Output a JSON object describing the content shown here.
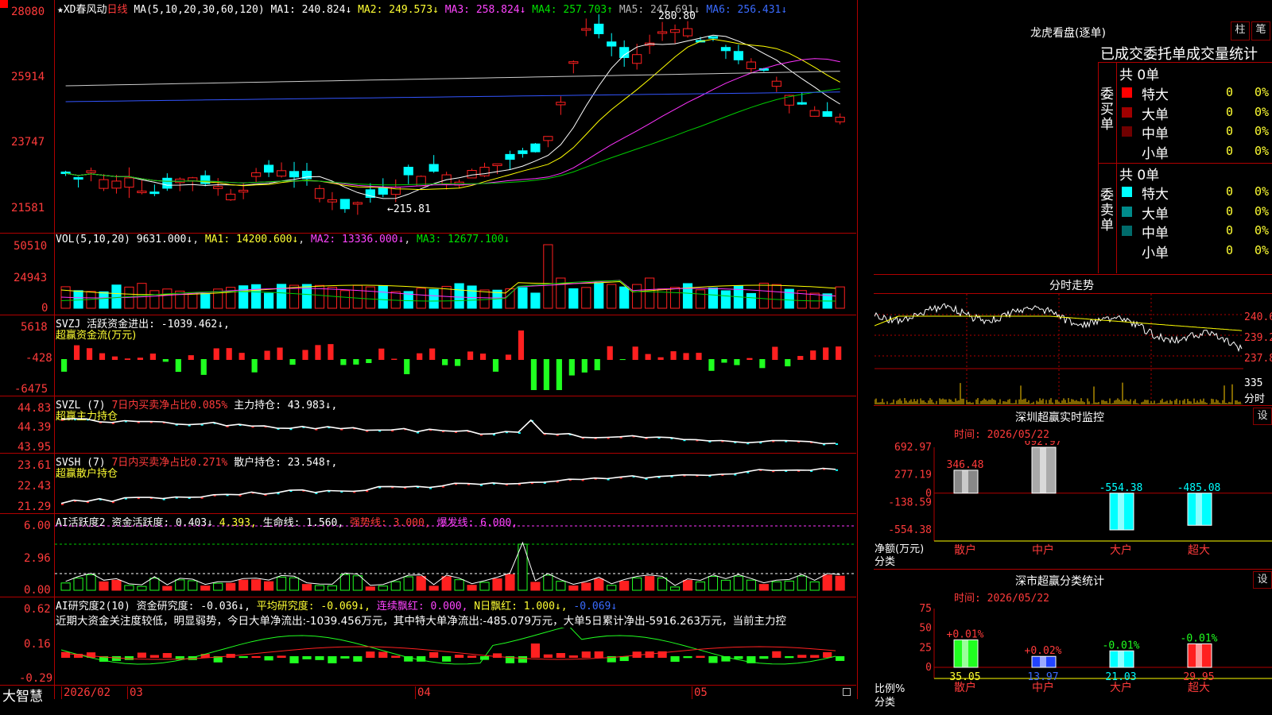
{
  "stock_name": "XD春风动",
  "period": "日线",
  "star": "★",
  "main_panel": {
    "ma_label": "MA(5,10,20,30,60,120)",
    "ma1": "MA1: 240.824↓",
    "ma2": "MA2: 249.573↓",
    "ma3": "MA3: 258.824↓",
    "ma4": "MA4: 257.703↑",
    "ma5": "MA5: 247.691↓",
    "ma6": "MA6: 256.431↓",
    "yticks": [
      "28080",
      "25914",
      "23747",
      "21581"
    ],
    "high_label": "280.80",
    "low_label": "215.81"
  },
  "vol_panel": {
    "title": "VOL(5,10,20)",
    "value": "9631.000↓",
    "ma1": "MA1: 14200.600↓",
    "ma2": "MA2: 13336.000↓",
    "ma3": "MA3: 12677.100↓",
    "yticks": [
      "50510",
      "24943",
      "0"
    ]
  },
  "svzj_panel": {
    "title": "SVZJ",
    "label": "活跃资金进出: -1039.462↓,",
    "sub": "超赢资金流(万元)",
    "yticks": [
      "5618",
      "-428",
      "-6475"
    ]
  },
  "svzl_panel": {
    "title": "SVZL (7)",
    "label1": "7日内买卖净占比0.085%",
    "label2": "主力持仓: 43.983↓,",
    "sub": "超赢主力持仓",
    "yticks": [
      "44.83",
      "44.39",
      "43.95"
    ]
  },
  "svsh_panel": {
    "title": "SVSH (7)",
    "label1": "7日内买卖净占比0.271%",
    "label2": "散户持仓: 23.548↑,",
    "sub": "超赢散户持仓",
    "yticks": [
      "23.61",
      "22.43",
      "21.29"
    ]
  },
  "ai_panel": {
    "title": "AI活跃度2",
    "label1": "资金活跃度: 0.403↓",
    "label2": "4.393,",
    "label3": "生命线: 1.560,",
    "label4": "强势线: 3.000,",
    "label5": "爆发线: 6.000,",
    "yticks": [
      "6.00",
      "2.96",
      "0.00"
    ]
  },
  "research_panel": {
    "title": "AI研究度2(10)",
    "label1": "资金研究度: -0.036↓,",
    "label2": "平均研究度: -0.069↓,",
    "label3": "连续飘红: 0.000,",
    "label4": "N日飘红: 1.000↓,",
    "label5": "-0.069↓",
    "comment": "近期大资金关注度较低，明显弱势，今日大单净流出:-1039.456万元，其中特大单净流出:-485.079万元，大单5日累计净出-5916.263万元，当前主力控",
    "yticks": [
      "0.62",
      "0.16",
      "-0.29"
    ]
  },
  "bottom_bar": {
    "brand": "大智慧",
    "dates": [
      "2026/02",
      "03",
      "04",
      "05"
    ]
  },
  "right_panel": {
    "dragon_title": "龙虎看盘(逐单)",
    "btn1": "柱",
    "btn2": "笔",
    "table_title": "已成交委托单成交量统计",
    "buy_label": "委买单",
    "sell_label": "委卖单",
    "buy_total": "共 0单",
    "sell_total": "共 0单",
    "buy_rows": [
      {
        "name": "特大",
        "count": "0",
        "pct": "0%",
        "color": "#ff0000"
      },
      {
        "name": "大单",
        "count": "0",
        "pct": "0%",
        "color": "#a00000"
      },
      {
        "name": "中单",
        "count": "0",
        "pct": "0%",
        "color": "#700000"
      },
      {
        "name": "小单",
        "count": "0",
        "pct": "0%",
        "color": ""
      }
    ],
    "sell_rows": [
      {
        "name": "特大",
        "count": "0",
        "pct": "0%",
        "color": "#00ffff"
      },
      {
        "name": "大单",
        "count": "0",
        "pct": "0%",
        "color": "#008b8b"
      },
      {
        "name": "中单",
        "count": "0",
        "pct": "0%",
        "color": "#006b6b"
      },
      {
        "name": "小单",
        "count": "0",
        "pct": "0%",
        "color": ""
      }
    ],
    "intraday_title": "分时走势",
    "intraday_prices": [
      "240.6",
      "239.2",
      "237.8"
    ],
    "intraday_vol": [
      "335"
    ],
    "intraday_vol_label": "分时",
    "monitor_title": "深圳超赢实时监控",
    "monitor_btn": "设",
    "monitor_time": "时间: 2026/05/22",
    "monitor_yticks": [
      "692.97",
      "277.19",
      "0",
      "-138.59",
      "-554.38"
    ],
    "monitor_ylabel": "净额(万元)",
    "monitor_xlabel": "分类",
    "classify_title": "深市超赢分类统计",
    "classify_btn": "设",
    "classify_time": "时间: 2026/05/22",
    "classify_yticks": [
      "75",
      "50",
      "25",
      "0"
    ],
    "classify_ylabel": "比例%",
    "classify_xlabel": "分类"
  },
  "chart_data": [
    {
      "type": "bar",
      "title": "深圳超赢实时监控",
      "categories": [
        "散户",
        "中户",
        "大户",
        "超大"
      ],
      "values": [
        346.48,
        692.97,
        -554.38,
        -485.08
      ],
      "ylabel": "净额(万元)",
      "ylim": [
        -554.38,
        692.97
      ]
    },
    {
      "type": "bar",
      "title": "深市超赢分类统计",
      "categories": [
        "散户",
        "中户",
        "大户",
        "超大"
      ],
      "values": [
        35.05,
        13.97,
        21.03,
        29.95
      ],
      "changes": [
        "+0.01%",
        "+0.02%",
        "-0.01%",
        "-0.01%"
      ],
      "ylabel": "比例%",
      "ylim": [
        0,
        75
      ]
    }
  ],
  "colors": {
    "up": "#ff2020",
    "down": "#00ffff",
    "frame": "#b00000",
    "ma1": "#ffffff",
    "ma2": "#ffff00",
    "ma3": "#ff33ff",
    "ma4": "#00cc00",
    "ma5": "#cccccc",
    "ma6": "#3355ff"
  }
}
